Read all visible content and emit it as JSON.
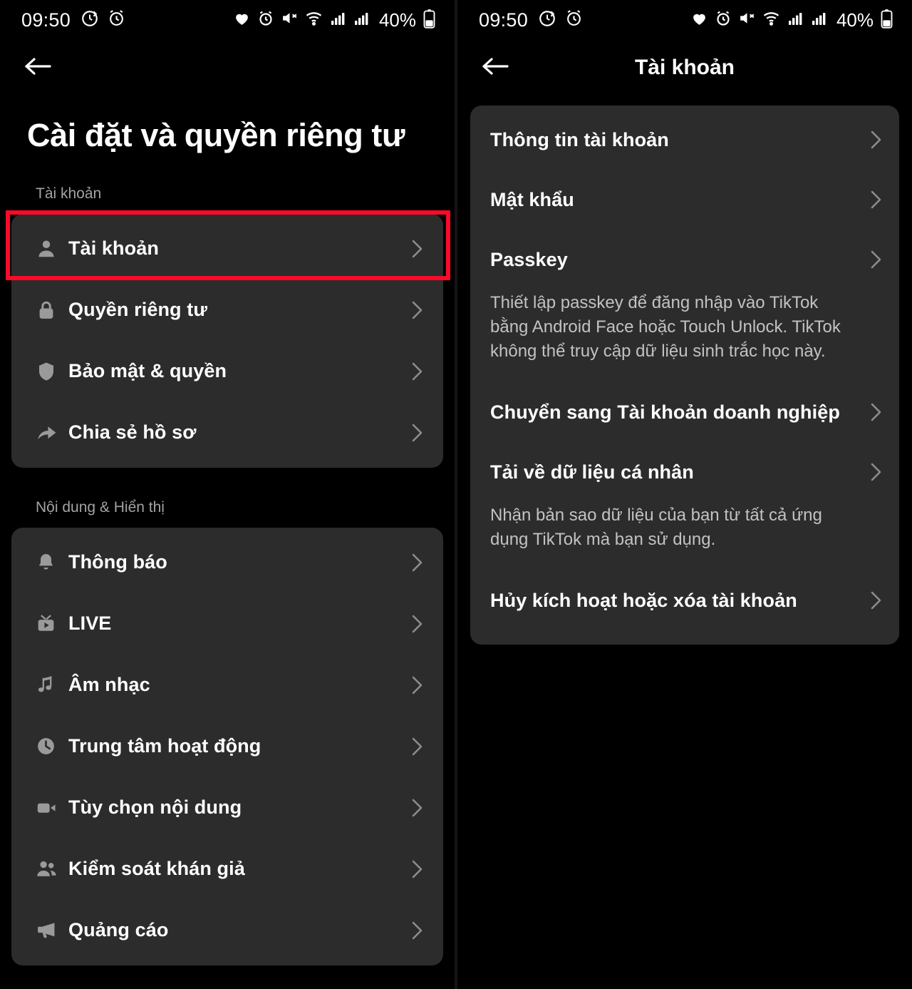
{
  "status_bar": {
    "time": "09:50",
    "left_icons": [
      "sync-icon",
      "alarm-icon"
    ],
    "right_icons": [
      "heart-icon",
      "alarm-icon",
      "mute-icon",
      "wifi-icon",
      "signal-icon",
      "signal-icon"
    ],
    "battery_percent": "40%"
  },
  "colors": {
    "highlight": "#fb0a2a",
    "card_bg": "#2c2c2c",
    "page_bg": "#000000",
    "label": "#ffffff",
    "muted": "#a3a3a3"
  },
  "left_screen": {
    "back_icon": "back-arrow-icon",
    "page_title": "Cài đặt và quyền riêng tư",
    "sections": [
      {
        "header": "Tài khoản",
        "items": [
          {
            "icon": "person-icon",
            "label": "Tài khoản",
            "chevron": "chevron-right-icon",
            "highlighted": true
          },
          {
            "icon": "lock-icon",
            "label": "Quyền riêng tư",
            "chevron": "chevron-right-icon",
            "highlighted": false
          },
          {
            "icon": "shield-icon",
            "label": "Bảo mật & quyền",
            "chevron": "chevron-right-icon",
            "highlighted": false
          },
          {
            "icon": "share-icon",
            "label": "Chia sẻ hồ sơ",
            "chevron": "chevron-right-icon",
            "highlighted": false
          }
        ]
      },
      {
        "header": "Nội dung & Hiển thị",
        "items": [
          {
            "icon": "bell-icon",
            "label": "Thông báo",
            "chevron": "chevron-right-icon",
            "highlighted": false
          },
          {
            "icon": "tv-icon",
            "label": "LIVE",
            "chevron": "chevron-right-icon",
            "highlighted": false
          },
          {
            "icon": "music-icon",
            "label": "Âm nhạc",
            "chevron": "chevron-right-icon",
            "highlighted": false
          },
          {
            "icon": "clock-icon",
            "label": "Trung tâm hoạt động",
            "chevron": "chevron-right-icon",
            "highlighted": false
          },
          {
            "icon": "video-icon",
            "label": "Tùy chọn nội dung",
            "chevron": "chevron-right-icon",
            "highlighted": false
          },
          {
            "icon": "people-icon",
            "label": "Kiểm soát khán giả",
            "chevron": "chevron-right-icon",
            "highlighted": false
          },
          {
            "icon": "megaphone-icon",
            "label": "Quảng cáo",
            "chevron": "chevron-right-icon",
            "highlighted": false
          }
        ]
      }
    ]
  },
  "right_screen": {
    "back_icon": "back-arrow-icon",
    "title": "Tài khoản",
    "items": [
      {
        "label": "Thông tin tài khoản",
        "desc": "",
        "chevron": "chevron-right-icon",
        "highlighted": false
      },
      {
        "label": "Mật khẩu",
        "desc": "",
        "chevron": "chevron-right-icon",
        "highlighted": false
      },
      {
        "label": "Passkey",
        "desc": "Thiết lập passkey để đăng nhập vào TikTok bằng Android Face hoặc Touch Unlock. TikTok không thể truy cập dữ liệu sinh trắc học này.",
        "chevron": "chevron-right-icon",
        "highlighted": false
      },
      {
        "label": "Chuyển sang Tài khoản doanh nghiệp",
        "desc": "",
        "chevron": "chevron-right-icon",
        "highlighted": false
      },
      {
        "label": "Tải về dữ liệu cá nhân",
        "desc": "Nhận bản sao dữ liệu của bạn từ tất cả ứng dụng TikTok mà bạn sử dụng.",
        "chevron": "chevron-right-icon",
        "highlighted": false
      },
      {
        "label": "Hủy kích hoạt hoặc xóa tài khoản",
        "desc": "",
        "chevron": "chevron-right-icon",
        "highlighted": true
      }
    ]
  }
}
